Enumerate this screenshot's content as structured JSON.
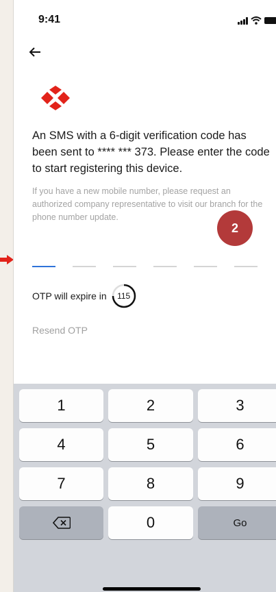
{
  "status_bar": {
    "time": "9:41"
  },
  "message": {
    "headline": "An SMS with a 6-digit verification code has been sent to **** *** 373. Please enter the code to start registering this device.",
    "note": "If you have a new mobile number, please request an authorized company representative to visit our branch for the phone number update."
  },
  "step_badge": "2",
  "otp": {
    "digits": [
      "",
      "",
      "",
      "",
      "",
      ""
    ],
    "active_index": 0
  },
  "timer": {
    "label": "OTP will expire in",
    "seconds": "115"
  },
  "resend_label": "Resend OTP",
  "keyboard": {
    "keys": [
      "1",
      "2",
      "3",
      "4",
      "5",
      "6",
      "7",
      "8",
      "9",
      "",
      "0",
      "Go"
    ]
  },
  "colors": {
    "brand_red": "#e2231a",
    "badge": "#b33a3a",
    "active_underline": "#2f73d9"
  }
}
